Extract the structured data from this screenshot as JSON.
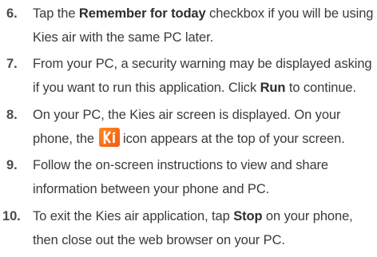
{
  "steps": [
    {
      "number": "6.",
      "line1_a": "Tap the ",
      "line1_bold": "Remember for today",
      "line1_b": " checkbox if you will be using",
      "line2": "Kies air with the same PC later."
    },
    {
      "number": "7.",
      "line1": "From your PC, a security warning may be displayed asking",
      "line2_a": "if you want to run this application. Click ",
      "line2_bold": "Run",
      "line2_b": " to continue."
    },
    {
      "number": "8.",
      "line1": "On your PC, the Kies air screen is displayed. On your",
      "line2_a": "phone, the",
      "icon": "kies-air-icon",
      "line2_b": "icon appears at the top of your screen."
    },
    {
      "number": "9.",
      "line1": "Follow the on-screen instructions to view and share",
      "line2": "information between your phone and PC."
    },
    {
      "number": "10.",
      "line1_a": "To exit the Kies air application, tap ",
      "line1_bold": "Stop",
      "line1_b": " on your phone,",
      "line2": "then close out the web browser on your PC."
    }
  ],
  "colors": {
    "text": "#3a3a3a",
    "icon_orange": "#f26a1b"
  }
}
